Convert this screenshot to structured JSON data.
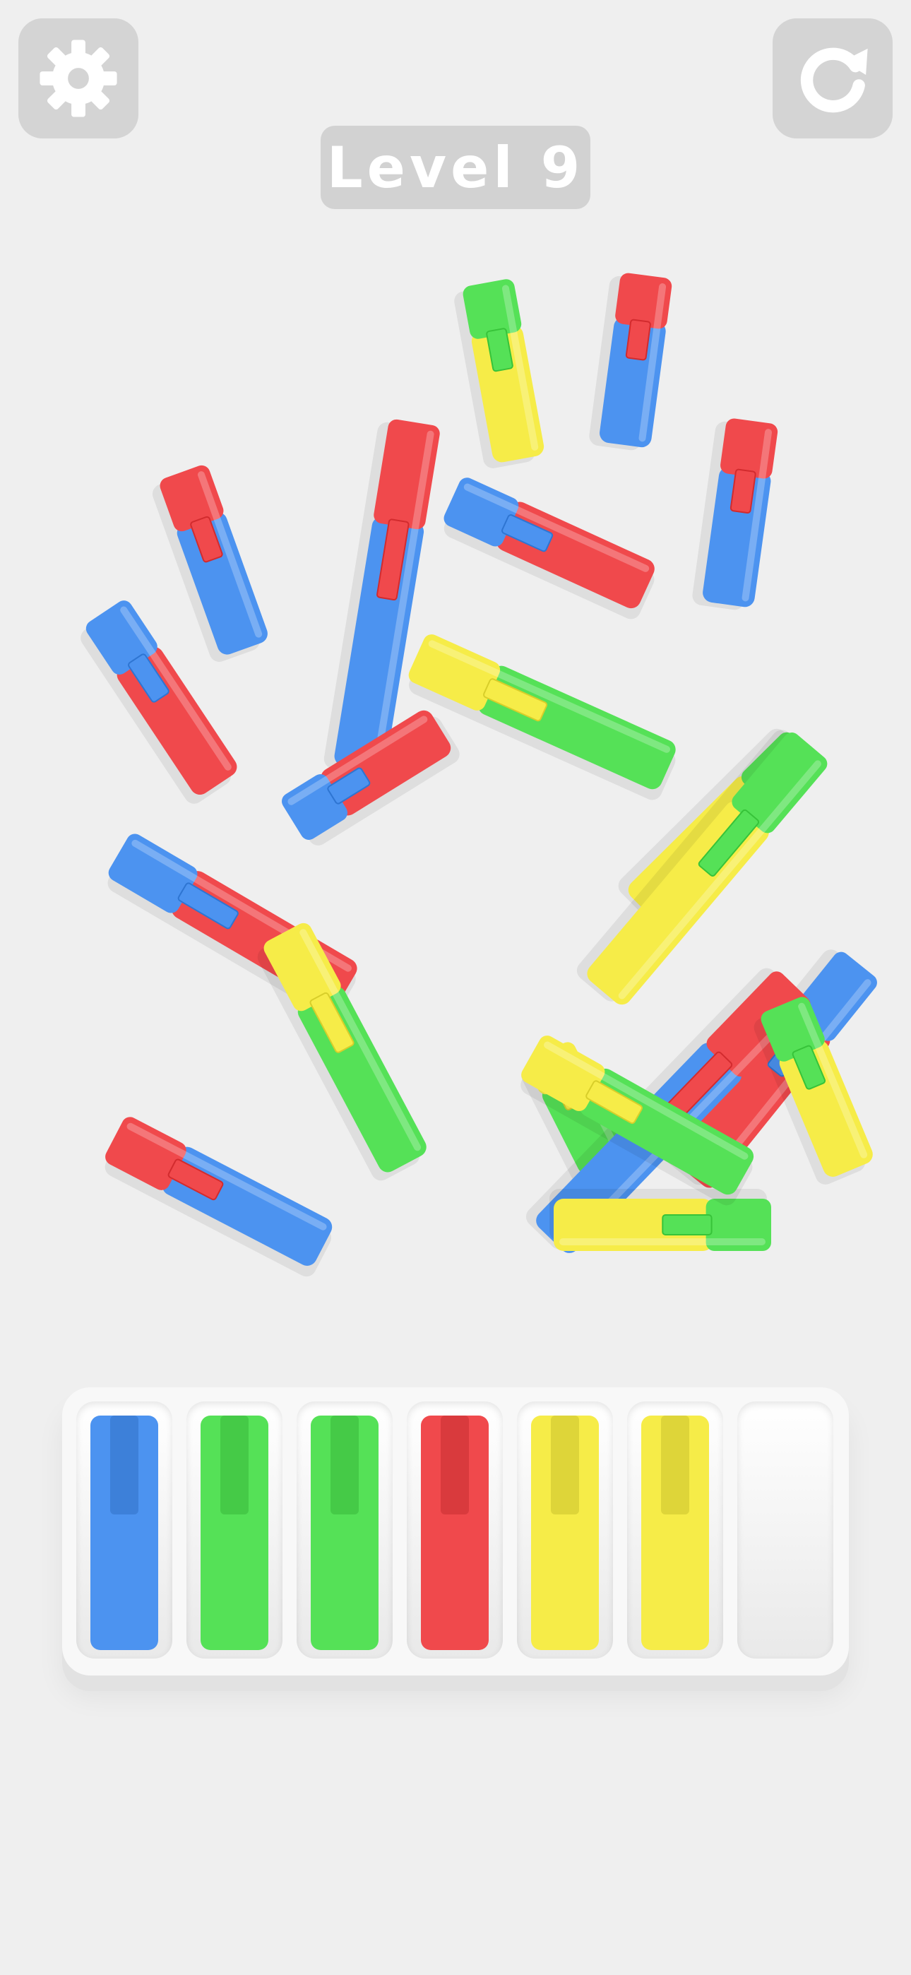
{
  "level": {
    "label": "Level 9"
  },
  "controls": {
    "settings_icon": "gear-icon",
    "restart_icon": "restart-arrow-icon"
  },
  "colors": {
    "red": "#f0494c",
    "blue": "#4c93f0",
    "green": "#55e157",
    "yellow": "#f6ec48",
    "background": "#efefef",
    "button": "#d4d4d4"
  },
  "markers": [
    {
      "body": "yellow",
      "cap": "green"
    },
    {
      "body": "blue",
      "cap": "red"
    },
    {
      "body": "blue",
      "cap": "red"
    },
    {
      "body": "red",
      "cap": "blue"
    },
    {
      "body": "blue",
      "cap": "red"
    },
    {
      "body": "red",
      "cap": "blue"
    },
    {
      "body": "blue",
      "cap": "red"
    },
    {
      "body": "green",
      "cap": "yellow"
    },
    {
      "body": "red",
      "cap": "blue"
    },
    {
      "body": "yellow",
      "cap": "green"
    },
    {
      "body": "green",
      "cap": "yellow"
    },
    {
      "body": "yellow",
      "cap": "green"
    },
    {
      "body": "red",
      "cap": "blue"
    },
    {
      "body": "red",
      "cap": "blue"
    },
    {
      "body": "green",
      "cap": "yellow"
    },
    {
      "body": "blue",
      "cap": "red"
    },
    {
      "body": "yellow",
      "cap": "green"
    },
    {
      "body": "yellow",
      "cap": "green"
    },
    {
      "body": "green",
      "cap": "yellow"
    },
    {
      "body": "blue",
      "cap": "red"
    }
  ],
  "tray": {
    "slots": [
      {
        "color": "blue"
      },
      {
        "color": "green"
      },
      {
        "color": "green"
      },
      {
        "color": "red"
      },
      {
        "color": "yellow"
      },
      {
        "color": "yellow"
      },
      {
        "color": null
      }
    ]
  }
}
